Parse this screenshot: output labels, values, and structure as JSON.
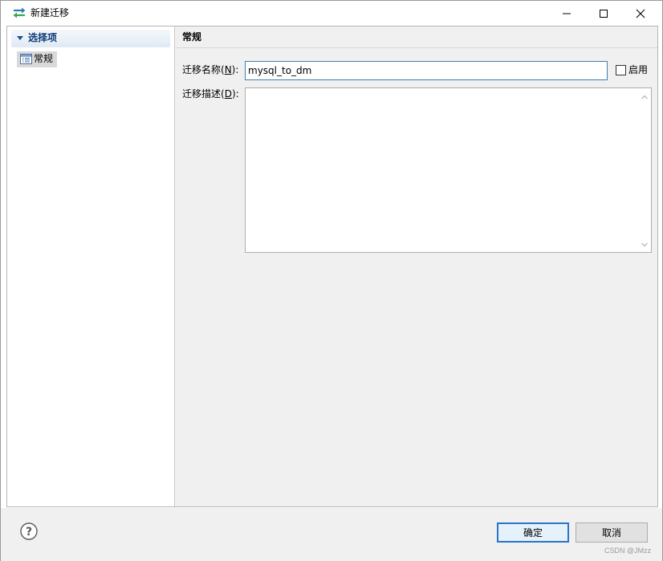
{
  "window": {
    "title": "新建迁移",
    "title_icon": "migrate-arrows-icon"
  },
  "title_controls": {
    "minimize": "minimize-icon",
    "maximize": "maximize-icon",
    "close": "close-icon"
  },
  "sidebar": {
    "header": "选择项",
    "items": [
      {
        "label": "常规",
        "icon": "form-list-icon",
        "selected": true
      }
    ]
  },
  "general": {
    "section_title": "常规",
    "name_label": "迁移名称(N):",
    "name_label_prefix": "迁移名称(",
    "name_label_mnemonic": "N",
    "name_label_suffix": "):",
    "name_value": "mysql_to_dm",
    "enable_label": "启用",
    "enable_checked": false,
    "desc_label": "迁移描述(D):",
    "desc_label_prefix": "迁移描述(",
    "desc_label_mnemonic": "D",
    "desc_label_suffix": "):",
    "desc_value": ""
  },
  "footer": {
    "ok_label": "确定",
    "cancel_label": "取消",
    "help_icon": "help-icon"
  },
  "watermark": "CSDN @JMzz"
}
